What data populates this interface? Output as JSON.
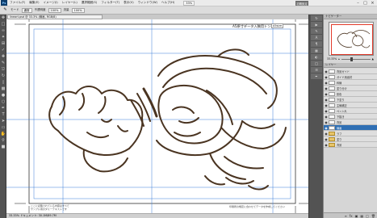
{
  "menubar": {
    "logo": "Ps",
    "items": [
      "ファイル(F)",
      "編集(E)",
      "イメージ(I)",
      "レイヤー(L)",
      "選択範囲(S)",
      "フィルター(T)",
      "表示(V)",
      "ウィンドウ(W)",
      "ヘルプ(H)"
    ],
    "zoom": "33%",
    "workspace": "初期設定"
  },
  "optionbar": {
    "mode_label": "モード",
    "mode_value": "通常",
    "opacity_label": "不透明度",
    "opacity_value": "100%",
    "flow_label": "流量",
    "flow_value": "100%"
  },
  "document": {
    "tab": "lineart.psd @ 33.3% (線画, RGB/8)",
    "title": "A5原寸データ入稿用トンボ",
    "mini_tag": "A5size",
    "footer_left": [
      "ここに記載されている内容はすべて",
      "サンプル用のダミーテキストです"
    ],
    "footer_right": "印刷所の規定に合わせてデータを作成してください"
  },
  "statusbar": {
    "text": "33.33%   ドキュメント: 30.1M/89.7M"
  },
  "navigator": {
    "title": "ナビゲーター",
    "zoom": "33.33%"
  },
  "layers": {
    "title": "レイヤー",
    "items": [
      {
        "label": "背景ガイド",
        "folder": false,
        "active": false
      },
      {
        "label": "ガイド用素材",
        "folder": false,
        "active": false
      },
      {
        "label": "枠線",
        "folder": false,
        "active": false
      },
      {
        "label": "塗り分け",
        "folder": false,
        "active": false
      },
      {
        "label": "影色",
        "folder": false,
        "active": false
      },
      {
        "label": "下塗り",
        "folder": false,
        "active": false
      },
      {
        "label": "主線補正",
        "folder": false,
        "active": false
      },
      {
        "label": "ペン入れ",
        "folder": false,
        "active": false
      },
      {
        "label": "下描き",
        "folder": false,
        "active": false
      },
      {
        "label": "背景",
        "folder": false,
        "active": false
      },
      {
        "label": "線画",
        "folder": false,
        "active": true
      },
      {
        "label": "ラフ",
        "folder": true,
        "active": false
      },
      {
        "label": "塗り",
        "folder": true,
        "active": false
      },
      {
        "label": "背景",
        "folder": true,
        "active": false
      }
    ]
  },
  "colors": {
    "line_art": "#4a3421",
    "guide": "#3b7fd8",
    "active_layer": "#2f6fb4"
  }
}
